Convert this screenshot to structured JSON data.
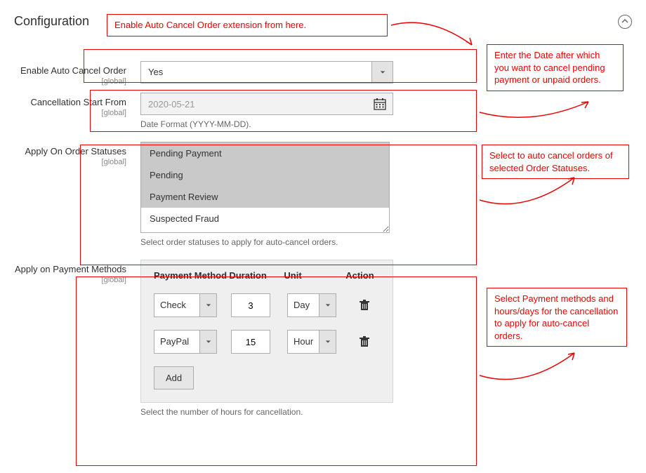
{
  "header": {
    "title": "Configuration"
  },
  "callouts": {
    "c1": "Enable Auto Cancel Order extension from here.",
    "c2": "Enter the Date after which you want to cancel pending payment or unpaid orders.",
    "c3": "Select to auto cancel orders of selected Order Statuses.",
    "c4": "Select Payment methods and hours/days for the cancellation to apply for auto-cancel orders."
  },
  "fields": {
    "enable": {
      "label": "Enable Auto Cancel Order",
      "scope": "[global]",
      "value": "Yes"
    },
    "start": {
      "label": "Cancellation Start From",
      "scope": "[global]",
      "value": "2020-05-21",
      "note": "Date Format (YYYY-MM-DD)."
    },
    "statuses": {
      "label": "Apply On Order Statuses",
      "scope": "[global]",
      "options": [
        {
          "text": "Pending Payment",
          "selected": true
        },
        {
          "text": "Pending",
          "selected": true
        },
        {
          "text": "Payment Review",
          "selected": true
        },
        {
          "text": "Suspected Fraud",
          "selected": false
        }
      ],
      "note": "Select order statuses to apply for auto-cancel orders."
    },
    "methods": {
      "label": "Apply on Payment Methods",
      "scope": "[global]",
      "headers": {
        "method": "Payment Method",
        "duration": "Duration",
        "unit": "Unit",
        "action": "Action"
      },
      "rows": [
        {
          "method": "Check",
          "duration": "3",
          "unit": "Day"
        },
        {
          "method": "PayPal",
          "duration": "15",
          "unit": "Hour"
        }
      ],
      "add_label": "Add",
      "note": "Select the number of hours for cancellation."
    }
  }
}
